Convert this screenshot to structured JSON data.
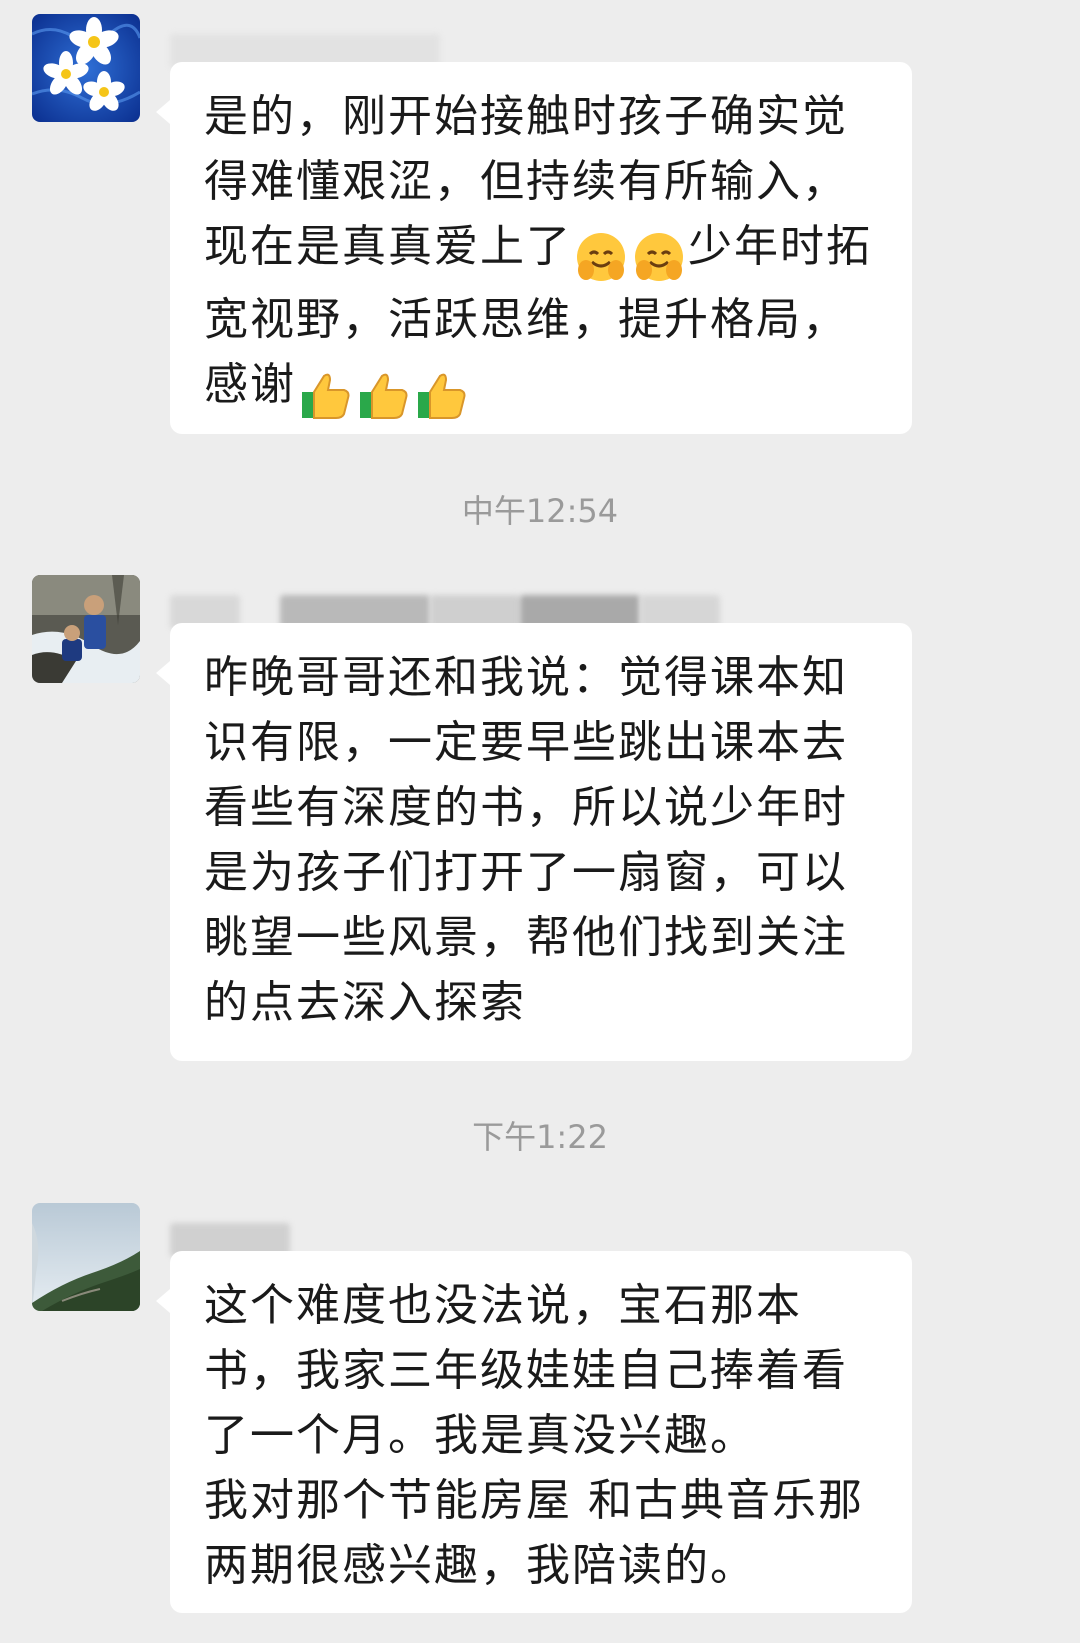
{
  "chat": {
    "messages": [
      {
        "text": "是的，刚开始接触时孩子确实觉得难懂艰涩，但持续有所输入，现在是真真爱上了",
        "emoji_1": "hugging-face-emoji",
        "text_2": "少年时拓宽视野，活跃思维，提升格局，感谢",
        "emoji_2": "thumbs-up-emoji"
      },
      {
        "text": "昨晚哥哥还和我说：觉得课本知识有限，一定要早些跳出课本去看些有深度的书，所以说少年时是为孩子们打开了一扇窗，可以眺望一些风景，帮他们找到关注的点去深入探索"
      },
      {
        "text": "这个难度也没法说，宝石那本书，我家三年级娃娃自己捧着看了一个月。我是真没兴趣。\n我对那个节能房屋 和古典音乐那两期很感兴趣，我陪读的。"
      }
    ],
    "timestamps": [
      "中午12:54",
      "下午1:22"
    ]
  },
  "colors": {
    "background": "#ededed",
    "bubble": "#ffffff",
    "timestamp": "#9a9a9a"
  }
}
